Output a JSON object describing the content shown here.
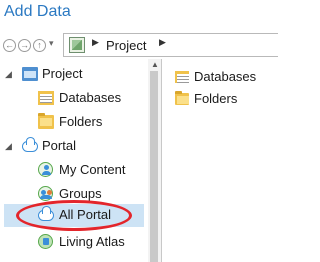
{
  "window": {
    "title": "Add Data"
  },
  "nav": {
    "back_icon": "back-arrow-icon",
    "forward_icon": "forward-arrow-icon",
    "up_icon": "up-arrow-icon",
    "path_icon": "project-map-icon",
    "path": "Project"
  },
  "tree": {
    "items": [
      {
        "label": "Project",
        "icon": "project-icon",
        "level": 0,
        "expanded": true
      },
      {
        "label": "Databases",
        "icon": "databases-folder-icon",
        "level": 1
      },
      {
        "label": "Folders",
        "icon": "folder-icon",
        "level": 1
      },
      {
        "label": "Portal",
        "icon": "cloud-icon",
        "level": 0,
        "expanded": true
      },
      {
        "label": "My Content",
        "icon": "user-icon",
        "level": 1
      },
      {
        "label": "Groups",
        "icon": "groups-icon",
        "level": 1
      },
      {
        "label": "All Portal",
        "icon": "cloud-icon",
        "level": 1,
        "selected": true,
        "annotation_color": "#e3252b"
      },
      {
        "label": "Living Atlas",
        "icon": "living-atlas-icon",
        "level": 1
      }
    ]
  },
  "content": {
    "items": [
      {
        "label": "Databases",
        "icon": "databases-folder-icon"
      },
      {
        "label": "Folders",
        "icon": "folder-icon"
      }
    ]
  },
  "colors": {
    "title": "#2b79c2",
    "selection": "#cde3f5",
    "annotation": "#e3252b"
  }
}
